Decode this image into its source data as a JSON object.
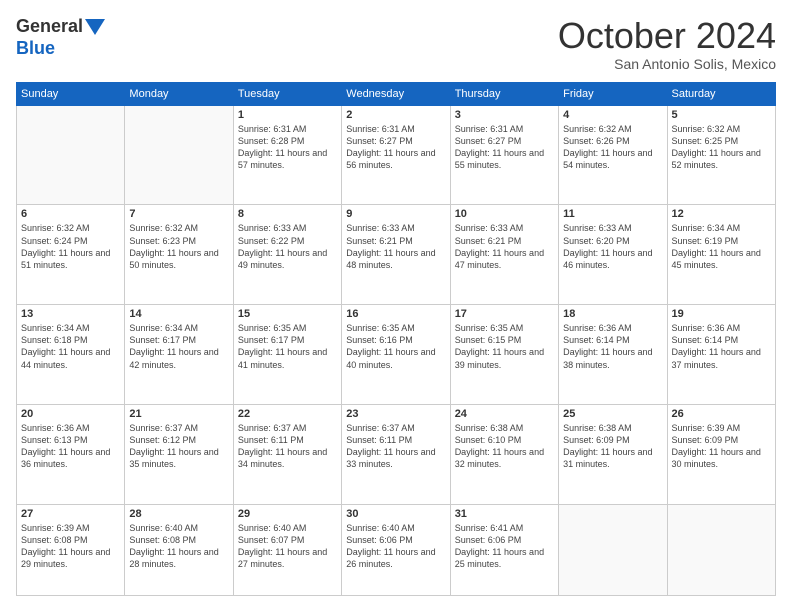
{
  "header": {
    "logo_line1": "General",
    "logo_line2": "Blue",
    "month_title": "October 2024",
    "location": "San Antonio Solis, Mexico"
  },
  "days_of_week": [
    "Sunday",
    "Monday",
    "Tuesday",
    "Wednesday",
    "Thursday",
    "Friday",
    "Saturday"
  ],
  "weeks": [
    [
      {
        "day": "",
        "info": ""
      },
      {
        "day": "",
        "info": ""
      },
      {
        "day": "1",
        "info": "Sunrise: 6:31 AM\nSunset: 6:28 PM\nDaylight: 11 hours and 57 minutes."
      },
      {
        "day": "2",
        "info": "Sunrise: 6:31 AM\nSunset: 6:27 PM\nDaylight: 11 hours and 56 minutes."
      },
      {
        "day": "3",
        "info": "Sunrise: 6:31 AM\nSunset: 6:27 PM\nDaylight: 11 hours and 55 minutes."
      },
      {
        "day": "4",
        "info": "Sunrise: 6:32 AM\nSunset: 6:26 PM\nDaylight: 11 hours and 54 minutes."
      },
      {
        "day": "5",
        "info": "Sunrise: 6:32 AM\nSunset: 6:25 PM\nDaylight: 11 hours and 52 minutes."
      }
    ],
    [
      {
        "day": "6",
        "info": "Sunrise: 6:32 AM\nSunset: 6:24 PM\nDaylight: 11 hours and 51 minutes."
      },
      {
        "day": "7",
        "info": "Sunrise: 6:32 AM\nSunset: 6:23 PM\nDaylight: 11 hours and 50 minutes."
      },
      {
        "day": "8",
        "info": "Sunrise: 6:33 AM\nSunset: 6:22 PM\nDaylight: 11 hours and 49 minutes."
      },
      {
        "day": "9",
        "info": "Sunrise: 6:33 AM\nSunset: 6:21 PM\nDaylight: 11 hours and 48 minutes."
      },
      {
        "day": "10",
        "info": "Sunrise: 6:33 AM\nSunset: 6:21 PM\nDaylight: 11 hours and 47 minutes."
      },
      {
        "day": "11",
        "info": "Sunrise: 6:33 AM\nSunset: 6:20 PM\nDaylight: 11 hours and 46 minutes."
      },
      {
        "day": "12",
        "info": "Sunrise: 6:34 AM\nSunset: 6:19 PM\nDaylight: 11 hours and 45 minutes."
      }
    ],
    [
      {
        "day": "13",
        "info": "Sunrise: 6:34 AM\nSunset: 6:18 PM\nDaylight: 11 hours and 44 minutes."
      },
      {
        "day": "14",
        "info": "Sunrise: 6:34 AM\nSunset: 6:17 PM\nDaylight: 11 hours and 42 minutes."
      },
      {
        "day": "15",
        "info": "Sunrise: 6:35 AM\nSunset: 6:17 PM\nDaylight: 11 hours and 41 minutes."
      },
      {
        "day": "16",
        "info": "Sunrise: 6:35 AM\nSunset: 6:16 PM\nDaylight: 11 hours and 40 minutes."
      },
      {
        "day": "17",
        "info": "Sunrise: 6:35 AM\nSunset: 6:15 PM\nDaylight: 11 hours and 39 minutes."
      },
      {
        "day": "18",
        "info": "Sunrise: 6:36 AM\nSunset: 6:14 PM\nDaylight: 11 hours and 38 minutes."
      },
      {
        "day": "19",
        "info": "Sunrise: 6:36 AM\nSunset: 6:14 PM\nDaylight: 11 hours and 37 minutes."
      }
    ],
    [
      {
        "day": "20",
        "info": "Sunrise: 6:36 AM\nSunset: 6:13 PM\nDaylight: 11 hours and 36 minutes."
      },
      {
        "day": "21",
        "info": "Sunrise: 6:37 AM\nSunset: 6:12 PM\nDaylight: 11 hours and 35 minutes."
      },
      {
        "day": "22",
        "info": "Sunrise: 6:37 AM\nSunset: 6:11 PM\nDaylight: 11 hours and 34 minutes."
      },
      {
        "day": "23",
        "info": "Sunrise: 6:37 AM\nSunset: 6:11 PM\nDaylight: 11 hours and 33 minutes."
      },
      {
        "day": "24",
        "info": "Sunrise: 6:38 AM\nSunset: 6:10 PM\nDaylight: 11 hours and 32 minutes."
      },
      {
        "day": "25",
        "info": "Sunrise: 6:38 AM\nSunset: 6:09 PM\nDaylight: 11 hours and 31 minutes."
      },
      {
        "day": "26",
        "info": "Sunrise: 6:39 AM\nSunset: 6:09 PM\nDaylight: 11 hours and 30 minutes."
      }
    ],
    [
      {
        "day": "27",
        "info": "Sunrise: 6:39 AM\nSunset: 6:08 PM\nDaylight: 11 hours and 29 minutes."
      },
      {
        "day": "28",
        "info": "Sunrise: 6:40 AM\nSunset: 6:08 PM\nDaylight: 11 hours and 28 minutes."
      },
      {
        "day": "29",
        "info": "Sunrise: 6:40 AM\nSunset: 6:07 PM\nDaylight: 11 hours and 27 minutes."
      },
      {
        "day": "30",
        "info": "Sunrise: 6:40 AM\nSunset: 6:06 PM\nDaylight: 11 hours and 26 minutes."
      },
      {
        "day": "31",
        "info": "Sunrise: 6:41 AM\nSunset: 6:06 PM\nDaylight: 11 hours and 25 minutes."
      },
      {
        "day": "",
        "info": ""
      },
      {
        "day": "",
        "info": ""
      }
    ]
  ]
}
